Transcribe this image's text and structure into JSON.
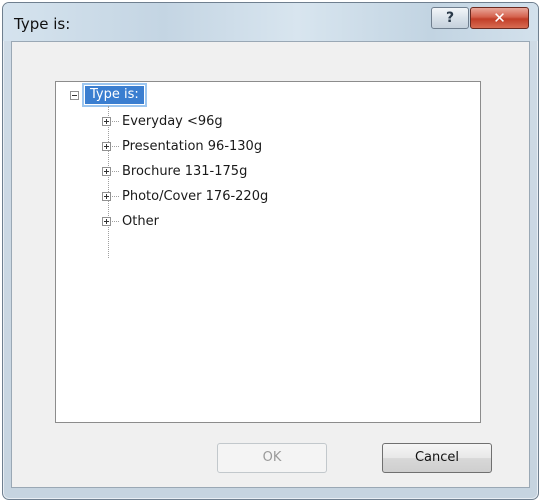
{
  "window": {
    "title": "Type is:",
    "help_label": "?",
    "close_label": "✕"
  },
  "tree": {
    "root_label": "Type is:",
    "root_expanded": true,
    "items": [
      {
        "label": "Everyday <96g"
      },
      {
        "label": "Presentation 96-130g"
      },
      {
        "label": "Brochure 131-175g"
      },
      {
        "label": "Photo/Cover 176-220g"
      },
      {
        "label": "Other"
      }
    ]
  },
  "buttons": {
    "ok_label": "OK",
    "ok_enabled": false,
    "cancel_label": "Cancel"
  },
  "colors": {
    "selection": "#3a7ed0",
    "close_button": "#c23e28"
  }
}
